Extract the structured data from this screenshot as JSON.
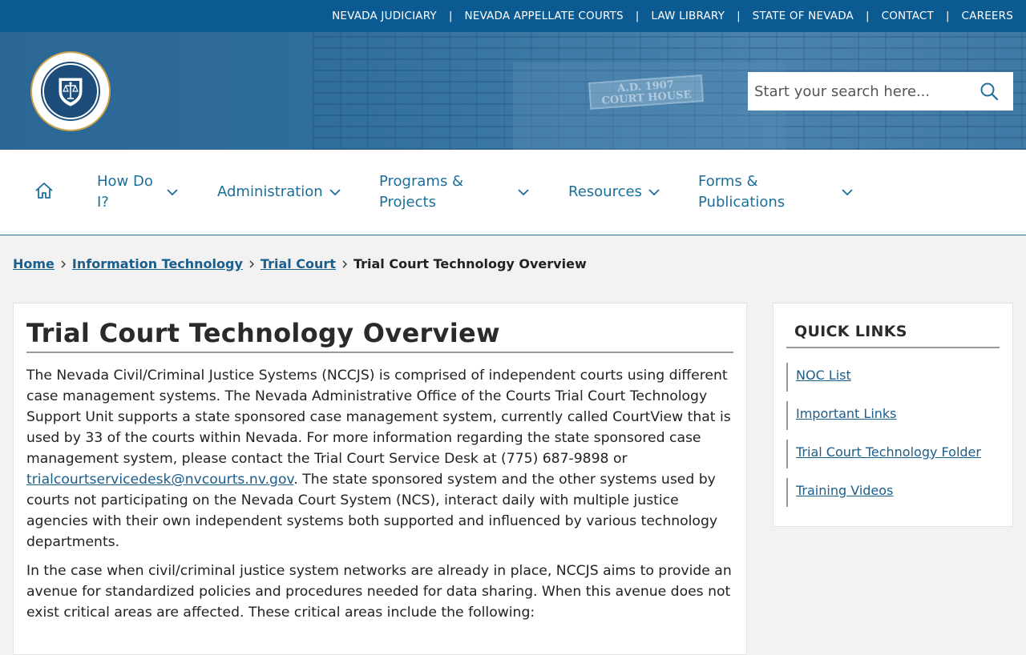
{
  "topbar": {
    "links": [
      "NEVADA JUDICIARY",
      "NEVADA APPELLATE COURTS",
      "LAW LIBRARY",
      "STATE OF NEVADA",
      "CONTACT",
      "CAREERS"
    ],
    "separator": "|"
  },
  "header": {
    "logo_icon": "aoc-seal-logo",
    "banner_sign": "A.D. 1907\nCOURT HOUSE",
    "search": {
      "placeholder": "Start your search here..."
    }
  },
  "nav": {
    "items": [
      {
        "line1": "How Do",
        "line2": "I?"
      },
      {
        "line1": "Administration",
        "line2": ""
      },
      {
        "line1": "Programs &",
        "line2": "Projects"
      },
      {
        "line1": "Resources",
        "line2": ""
      },
      {
        "line1": "Forms &",
        "line2": "Publications"
      }
    ]
  },
  "breadcrumb": {
    "links": [
      "Home",
      "Information Technology",
      "Trial Court"
    ],
    "current": "Trial Court Technology Overview"
  },
  "main": {
    "title": "Trial Court Technology Overview",
    "p1_before": "The Nevada Civil/Criminal Justice Systems (NCCJS) is comprised of independent courts using different case management systems. The Nevada Administrative Office of the Courts Trial Court Technology Support Unit supports a state sponsored case management system, currently called CourtView that is used by 33 of the courts within Nevada. For more information regarding the state sponsored case management system, please contact the Trial Court Service Desk at (775) 687-9898 or ",
    "p1_link": "trialcourtservicedesk@nvcourts.nv.gov",
    "p1_after": ". The state sponsored system and the other systems used by courts not participating on the Nevada Court System (NCS), interact daily with multiple justice agencies with their own independent systems both supported and influenced by various technology departments.",
    "p2": "In the case when civil/criminal justice system networks are already in place, NCCJS aims to provide an avenue for standardized policies and procedures needed for data sharing. When this avenue does not exist critical areas are affected. These critical areas include the following:"
  },
  "quick_links": {
    "title": "QUICK LINKS",
    "items": [
      "NOC List",
      "Important Links",
      "Trial Court Technology Folder",
      "Training Videos"
    ]
  },
  "colors": {
    "topbar_bg": "#0b5a92",
    "nav_text": "#1d6f99",
    "link": "#1a5e8c"
  }
}
